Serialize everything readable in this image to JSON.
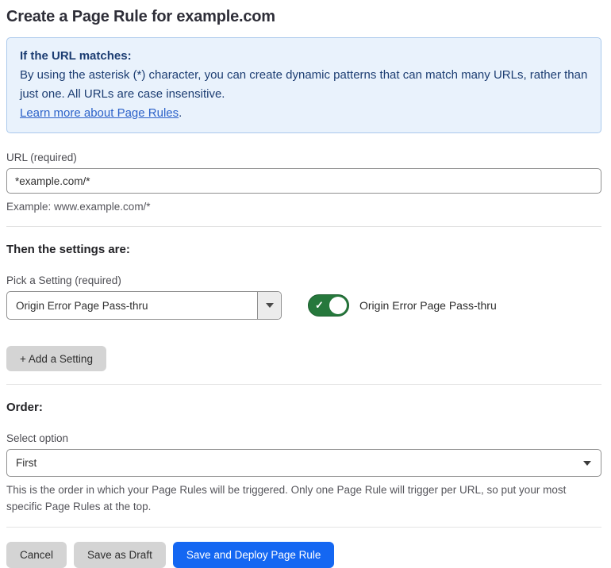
{
  "page": {
    "title": "Create a Page Rule for example.com"
  },
  "info_box": {
    "heading": "If the URL matches:",
    "body": "By using the asterisk (*) character, you can create dynamic patterns that can match many URLs, rather than just one. All URLs are case insensitive.",
    "link": "Learn more about Page Rules",
    "link_suffix": "."
  },
  "url_field": {
    "label": "URL (required)",
    "value": "*example.com/*",
    "example": "Example: www.example.com/*"
  },
  "settings_section": {
    "heading": "Then the settings are:",
    "picker_label": "Pick a Setting (required)",
    "picker_value": "Origin Error Page Pass-thru",
    "toggle_state": "on",
    "toggle_check": "✓",
    "toggle_label": "Origin Error Page Pass-thru",
    "add_setting_button": "+ Add a Setting"
  },
  "order_section": {
    "heading": "Order:",
    "select_label": "Select option",
    "select_value": "First",
    "help_text": "This is the order in which your Page Rules will be triggered. Only one Page Rule will trigger per URL, so put your most specific Page Rules at the top."
  },
  "footer": {
    "cancel": "Cancel",
    "save_draft": "Save as Draft",
    "save_deploy": "Save and Deploy Page Rule"
  },
  "colors": {
    "info_bg": "#e9f2fc",
    "info_border": "#abc9ec",
    "info_text": "#1c3d72",
    "link_blue": "#2c62c9",
    "toggle_green": "#26783c",
    "primary_blue": "#1467f2",
    "button_gray": "#d4d4d4"
  }
}
